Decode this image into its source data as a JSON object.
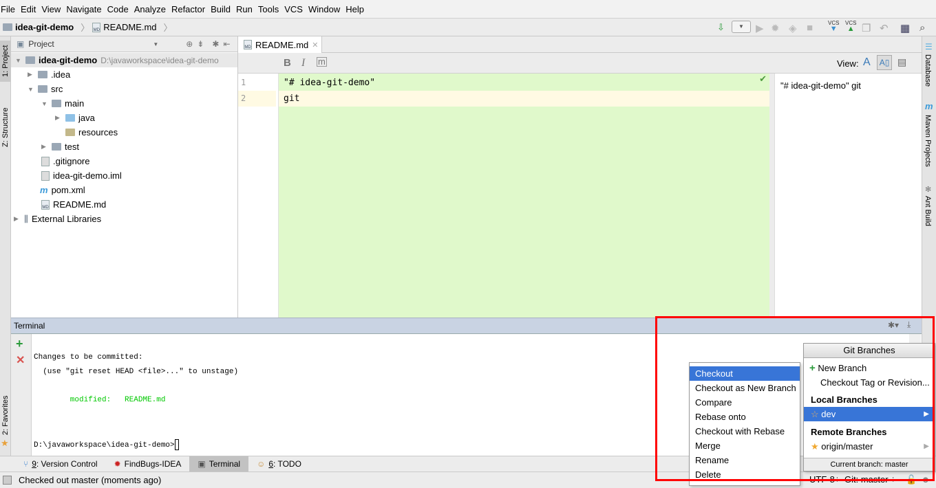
{
  "menu": [
    "File",
    "Edit",
    "View",
    "Navigate",
    "Code",
    "Analyze",
    "Refactor",
    "Build",
    "Run",
    "Tools",
    "VCS",
    "Window",
    "Help"
  ],
  "breadcrumb": {
    "project": "idea-git-demo",
    "file": "README.md"
  },
  "toolbar": {
    "vcs_update": "VCS",
    "vcs_commit": "VCS"
  },
  "left_stripe": {
    "project": "1: Project",
    "structure": "Z: Structure",
    "favorites": "2: Favorites"
  },
  "right_stripe": {
    "database": "Database",
    "maven": "Maven Projects",
    "ant": "Ant Build"
  },
  "project_panel": {
    "title": "Project",
    "tree": [
      {
        "label": "idea-git-demo",
        "path": "D:\\javaworkspace\\idea-git-demo",
        "expanded": true
      },
      {
        "label": ".idea",
        "expanded": false
      },
      {
        "label": "src",
        "expanded": true
      },
      {
        "label": "main",
        "expanded": true
      },
      {
        "label": "java",
        "expanded": false
      },
      {
        "label": "resources"
      },
      {
        "label": "test",
        "expanded": false
      },
      {
        "label": ".gitignore"
      },
      {
        "label": "idea-git-demo.iml"
      },
      {
        "label": "pom.xml"
      },
      {
        "label": "README.md"
      },
      {
        "label": "External Libraries",
        "expanded": false
      }
    ]
  },
  "editor": {
    "tab": "README.md",
    "view_label": "View:",
    "lines": [
      "\"# idea-git-demo\"",
      "git"
    ],
    "line_numbers": [
      "1",
      "2"
    ],
    "preview": "\"# idea-git-demo\" git"
  },
  "terminal": {
    "title": "Terminal",
    "lines": [
      "Changes to be committed:",
      "  (use \"git reset HEAD <file>...\" to unstage)",
      "        modified:   README.md",
      "D:\\javaworkspace\\idea-git-demo>"
    ]
  },
  "tool_tabs": [
    {
      "num": "9",
      "label": ": Version Control"
    },
    {
      "num": "",
      "label": "FindBugs-IDEA"
    },
    {
      "num": "",
      "label": "Terminal"
    },
    {
      "num": "6",
      "label": ": TODO"
    }
  ],
  "status": {
    "message": "Checked out master (moments ago)",
    "encoding": "UTF-8÷",
    "branch": "Git: master ÷"
  },
  "context_menu": [
    "Checkout",
    "Checkout as New Branch",
    "Compare",
    "Rebase onto",
    "Checkout with Rebase",
    "Merge",
    "Rename",
    "Delete"
  ],
  "git_branches": {
    "title": "Git Branches",
    "new_branch": "New Branch",
    "checkout_tag": "Checkout Tag or Revision...",
    "local_header": "Local Branches",
    "local": [
      "dev"
    ],
    "remote_header": "Remote Branches",
    "remote": [
      "origin/master"
    ],
    "current": "Current branch: master"
  },
  "colors": {
    "highlight": "#3875d7",
    "annotation": "#ff0000",
    "editor_bg": "#e0f9cb",
    "terminal_green": "#00c800"
  }
}
